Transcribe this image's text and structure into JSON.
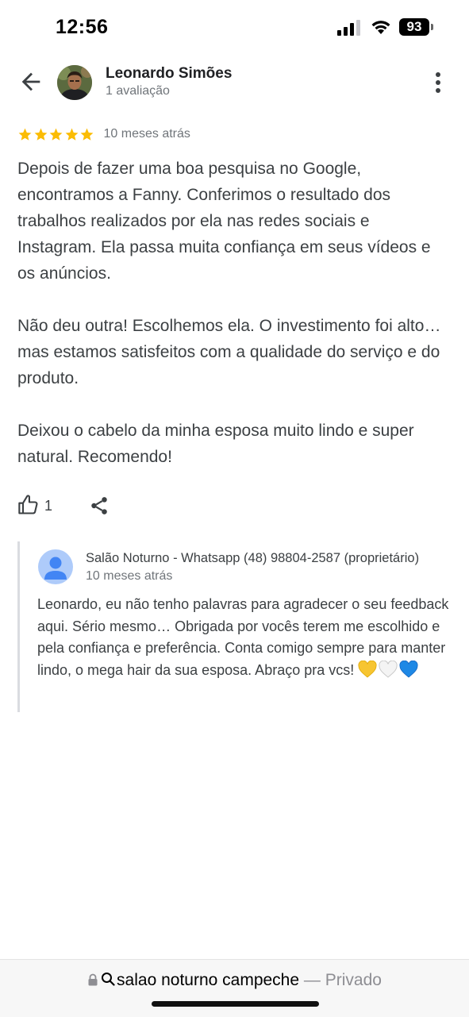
{
  "status_bar": {
    "time": "12:56",
    "battery": "93"
  },
  "header": {
    "reviewer_name": "Leonardo Simões",
    "review_count": "1 avaliação"
  },
  "review": {
    "stars": 5,
    "date": "10 meses atrás",
    "paragraphs": [
      "Depois de fazer uma boa pesquisa no Google, encontramos a Fanny. Conferimos o resultado dos trabalhos realizados por ela nas redes sociais e Instagram. Ela passa muita confiança em seus vídeos e os anúncios.",
      "Não deu outra! Escolhemos ela. O investimento foi alto…mas estamos satisfeitos com a qualidade do serviço e do produto.",
      "Deixou o cabelo da minha esposa muito lindo e super natural. Recomendo!"
    ],
    "like_count": "1"
  },
  "owner_reply": {
    "name": "Salão Noturno - Whatsapp (48) 98804-2587 (proprietário)",
    "date": "10 meses atrás",
    "text": "Leonardo, eu não tenho palavras para agradecer o seu feedback aqui. Sério mesmo… Obrigada por vocês terem me escolhido e pela confiança e preferência. Conta comigo sempre para manter lindo, o mega hair da sua esposa. Abraço pra vcs!"
  },
  "browser": {
    "url_text": "salao noturno campeche",
    "separator": "—",
    "mode": "Privado"
  },
  "colors": {
    "star": "#fbbc04",
    "text_secondary": "#70757a",
    "reply_border": "#dadce0",
    "owner_avatar": "#aecbfa",
    "owner_avatar_icon": "#4285f4"
  },
  "icons": [
    "back-arrow-icon",
    "more-vert-icon",
    "star-icon",
    "thumbs-up-icon",
    "share-icon",
    "person-icon",
    "yellow-heart-icon",
    "white-heart-icon",
    "blue-heart-icon",
    "lock-icon",
    "search-icon",
    "signal-icon",
    "wifi-icon",
    "battery-icon"
  ]
}
